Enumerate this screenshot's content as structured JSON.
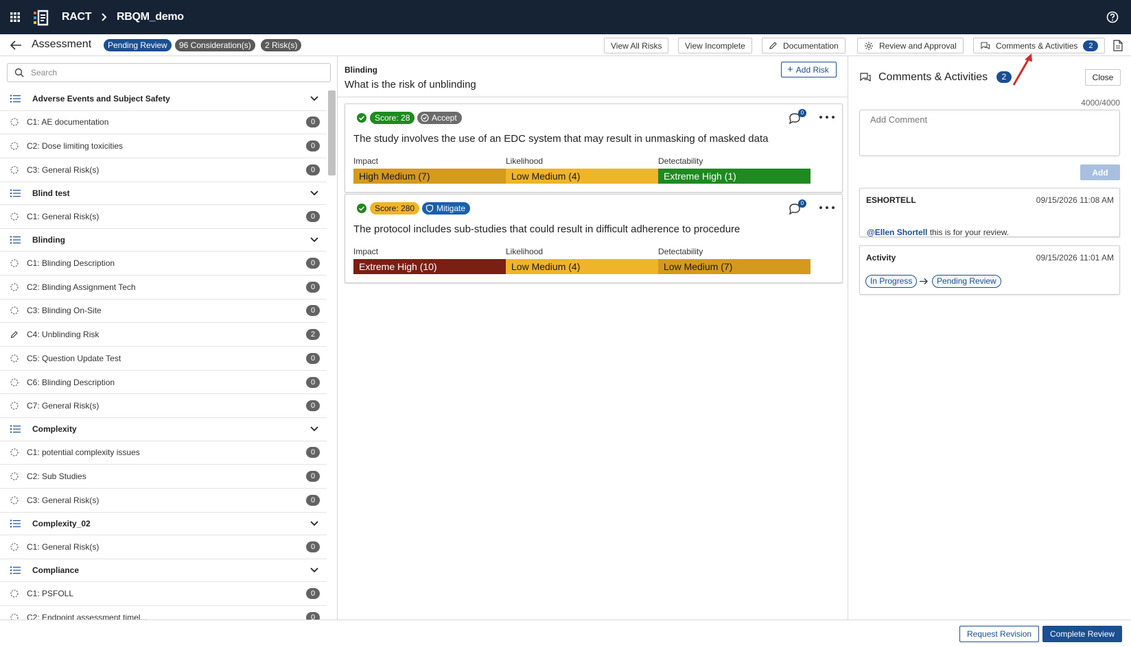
{
  "topbar": {
    "brand": "RACT",
    "study": "RBQM_demo"
  },
  "subheader": {
    "title": "Assessment",
    "status_pill": "Pending Review",
    "considerations_pill": "96 Consideration(s)",
    "risks_pill": "2 Risk(s)",
    "buttons": {
      "view_all_risks": "View All Risks",
      "view_incomplete": "View Incomplete",
      "documentation": "Documentation",
      "review_approval": "Review and Approval",
      "comments_activities": "Comments & Activities",
      "comments_count": "2"
    }
  },
  "sidebar": {
    "search_placeholder": "Search",
    "rows": [
      {
        "type": "group",
        "label": "Adverse Events and Subject Safety"
      },
      {
        "type": "item",
        "label": "C1: AE documentation",
        "count": "0",
        "icon": "dashed-circle-icon"
      },
      {
        "type": "item",
        "label": "C2: Dose limiting toxicities",
        "count": "0",
        "icon": "dashed-circle-icon"
      },
      {
        "type": "item",
        "label": "C3: General Risk(s)",
        "count": "0",
        "icon": "dashed-circle-icon"
      },
      {
        "type": "group",
        "label": "Blind test"
      },
      {
        "type": "item",
        "label": "C1: General Risk(s)",
        "count": "0",
        "icon": "dashed-circle-icon"
      },
      {
        "type": "group",
        "label": "Blinding"
      },
      {
        "type": "item",
        "label": "C1: Blinding Description",
        "count": "0",
        "icon": "dashed-circle-icon"
      },
      {
        "type": "item",
        "label": "C2: Blinding Assignment Tech",
        "count": "0",
        "icon": "dashed-circle-icon"
      },
      {
        "type": "item",
        "label": "C3: Blinding On-Site",
        "count": "0",
        "icon": "dashed-circle-icon"
      },
      {
        "type": "item",
        "label": "C4: Unblinding Risk",
        "count": "2",
        "icon": "pencil-icon"
      },
      {
        "type": "item",
        "label": "C5: Question Update Test",
        "count": "0",
        "icon": "dashed-circle-icon"
      },
      {
        "type": "item",
        "label": "C6: Blinding Description",
        "count": "0",
        "icon": "dashed-circle-icon"
      },
      {
        "type": "item",
        "label": "C7: General Risk(s)",
        "count": "0",
        "icon": "dashed-circle-icon"
      },
      {
        "type": "group",
        "label": "Complexity"
      },
      {
        "type": "item",
        "label": "C1: potential complexity issues",
        "count": "0",
        "icon": "dashed-circle-icon"
      },
      {
        "type": "item",
        "label": "C2: Sub Studies",
        "count": "0",
        "icon": "dashed-circle-icon"
      },
      {
        "type": "item",
        "label": "C3: General Risk(s)",
        "count": "0",
        "icon": "dashed-circle-icon"
      },
      {
        "type": "group",
        "label": "Complexity_02"
      },
      {
        "type": "item",
        "label": "C1: General Risk(s)",
        "count": "0",
        "icon": "dashed-circle-icon"
      },
      {
        "type": "group",
        "label": "Compliance"
      },
      {
        "type": "item",
        "label": "C1: PSFOLL",
        "count": "0",
        "icon": "dashed-circle-icon"
      },
      {
        "type": "item",
        "label": "C2: Endpoint assessment timel...",
        "count": "0",
        "icon": "dashed-circle-icon"
      }
    ]
  },
  "center": {
    "category": "Blinding",
    "question": "What is the risk of unblinding",
    "add_risk_label": "Add Risk",
    "labels": {
      "impact": "Impact",
      "likelihood": "Likelihood",
      "detectability": "Detectability"
    },
    "risks": [
      {
        "score": "Score: 28",
        "score_bg": "#1f8a1f",
        "score_fg": "#ffffff",
        "action": "Accept",
        "action_bg": "#6b6b6b",
        "action_icon": "check-circle-icon",
        "comment_count": "0",
        "description": "The study involves the use of an EDC system that may result in unmasking of masked data",
        "impact": {
          "text": "High Medium (7)",
          "bg": "#d49a1e",
          "fg": "#1a1a1a"
        },
        "likelihood": {
          "text": "Low Medium (4)",
          "bg": "#f0b429",
          "fg": "#1a1a1a"
        },
        "detectability": {
          "text": "Extreme High (1)",
          "bg": "#1f8a1f",
          "fg": "#ffffff"
        }
      },
      {
        "score": "Score: 280",
        "score_bg": "#f0b429",
        "score_fg": "#1a1a1a",
        "action": "Mitigate",
        "action_bg": "#1b5fae",
        "action_icon": "shield-icon",
        "comment_count": "0",
        "description": "The protocol includes sub-studies that could result in difficult adherence to procedure",
        "impact": {
          "text": "Extreme High (10)",
          "bg": "#7a1f14",
          "fg": "#ffffff"
        },
        "likelihood": {
          "text": "Low Medium (4)",
          "bg": "#f0b429",
          "fg": "#1a1a1a"
        },
        "detectability": {
          "text": "Low Medium (7)",
          "bg": "#d49a1e",
          "fg": "#1a1a1a"
        }
      }
    ]
  },
  "right": {
    "title": "Comments & Activities",
    "count": "2",
    "close_label": "Close",
    "char_count": "4000/4000",
    "comment_placeholder": "Add Comment",
    "add_label": "Add",
    "comment": {
      "user": "ESHORTELL",
      "time": "09/15/2026 11:08 AM",
      "mention": "@Ellen Shortell",
      "text": " this is for your review."
    },
    "activity": {
      "title": "Activity",
      "time": "09/15/2026 11:01 AM",
      "from": "In Progress",
      "to": "Pending Review"
    }
  },
  "footer": {
    "request_revision": "Request Revision",
    "complete_review": "Complete Review"
  },
  "colors": {
    "topbar": "#152335",
    "primary": "#1b4f91"
  }
}
